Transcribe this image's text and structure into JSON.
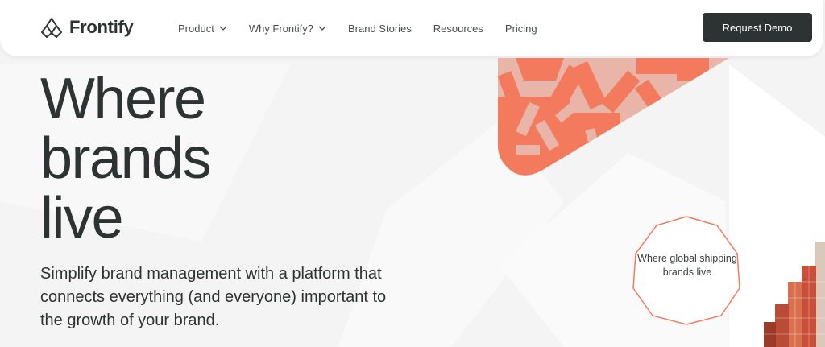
{
  "brand": {
    "name": "Frontify",
    "logo_icon": "frontify-logo-icon"
  },
  "nav": {
    "items": [
      {
        "label": "Product",
        "has_dropdown": true
      },
      {
        "label": "Why Frontify?",
        "has_dropdown": true
      },
      {
        "label": "Brand Stories",
        "has_dropdown": false
      },
      {
        "label": "Resources",
        "has_dropdown": false
      },
      {
        "label": "Pricing",
        "has_dropdown": false
      }
    ],
    "cta_label": "Request Demo"
  },
  "hero": {
    "title_lines": [
      "Where",
      "brands",
      "live"
    ],
    "subtitle": "Simplify brand management with a platform that connects everything (and everyone) important to the growth of your brand."
  },
  "badge": {
    "text": "Where global shipping brands live"
  },
  "colors": {
    "accent": "#f47a5e",
    "dark": "#2d3232",
    "background": "#f4f4f4"
  }
}
